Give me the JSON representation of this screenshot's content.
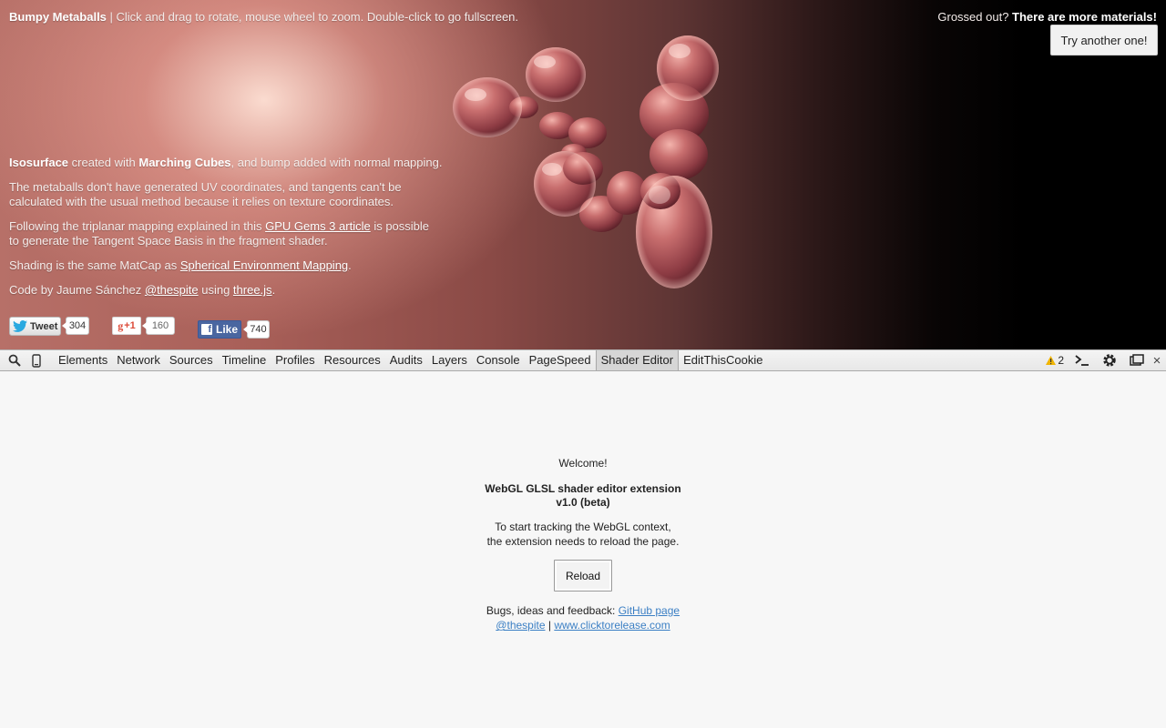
{
  "page": {
    "title_bold": "Bumpy Metaballs",
    "title_rest": " | Click and drag to rotate, mouse wheel to zoom. Double-click to go fullscreen.",
    "top_right_prefix": "Grossed out? ",
    "top_right_bold": "There are more materials!",
    "try_button": "Try another one!",
    "p1_b1": "Isosurface",
    "p1_t1": " created with ",
    "p1_b2": "Marching Cubes",
    "p1_t2": ", and bump added with normal mapping.",
    "p2_l1": "The metaballs don't have generated UV coordinates, and tangents can't be",
    "p2_l2": "calculated with the usual method because it relies on texture coordinates.",
    "p3_t1": "Following the triplanar mapping explained in this ",
    "p3_link": "GPU Gems 3 article",
    "p3_t2": " is possible",
    "p3_l2": "to generate the Tangent Space Basis in the fragment shader.",
    "p4_t1": "Shading is the same MatCap as ",
    "p4_link": "Spherical Environment Mapping",
    "p4_t2": ".",
    "p5_t1": "Code by Jaume Sánchez ",
    "p5_link1": "@thespite",
    "p5_t2": " using ",
    "p5_link2": "three.js",
    "p5_t3": ".",
    "tweet_label": "Tweet",
    "tweet_count": "304",
    "gplus_label": "+1",
    "gplus_count": "160",
    "like_label": "Like",
    "like_count": "740"
  },
  "devtools": {
    "tabs": [
      "Elements",
      "Network",
      "Sources",
      "Timeline",
      "Profiles",
      "Resources",
      "Audits",
      "Layers",
      "Console",
      "PageSpeed",
      "Shader Editor",
      "EditThisCookie"
    ],
    "selected_tab": "Shader Editor",
    "warning_count": "2",
    "close_glyph": "×"
  },
  "panel": {
    "welcome": "Welcome!",
    "title_l1": "WebGL GLSL shader editor extension",
    "title_l2": "v1.0 (beta)",
    "desc_l1": "To start tracking the WebGL context,",
    "desc_l2": "the extension needs to reload the page.",
    "reload_button": "Reload",
    "feedback_text": "Bugs, ideas and feedback: ",
    "github_link": "GitHub page",
    "twitter_link": "@thespite",
    "separator": " | ",
    "site_link": "www.clicktorelease.com"
  },
  "colors": {
    "link_blue": "#3b7fc4",
    "facebook_blue": "#4a66a0",
    "gplus_red": "#dd4b39",
    "warning_yellow": "#f0b400"
  }
}
